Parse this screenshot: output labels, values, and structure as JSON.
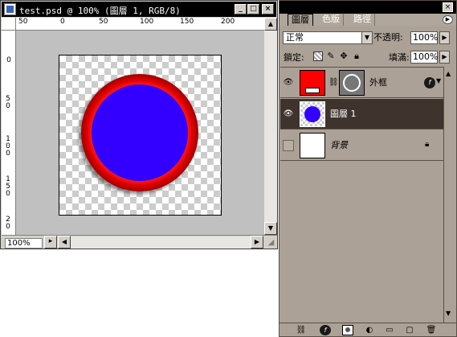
{
  "document": {
    "title": "test.psd @ 100% (圖層 1, RGB/8)",
    "zoom": "100%",
    "ruler_top_labels": [
      "50",
      "0",
      "50",
      "100",
      "150",
      "200"
    ],
    "ruler_left_labels": [
      {
        "text": "0"
      },
      {
        "text": "5 0"
      },
      {
        "text": "1 0 0"
      },
      {
        "text": "1 5 0"
      },
      {
        "text": "2 0"
      }
    ]
  },
  "layers_panel": {
    "tabs": [
      "圖層",
      "色版",
      "路徑"
    ],
    "blend_mode": "正常",
    "opacity_label": "不透明:",
    "opacity_value": "100%",
    "lock_label": "鎖定:",
    "fill_label": "填滿:",
    "fill_value": "100%",
    "layers": [
      {
        "name": "外框",
        "visible": true,
        "selected": false,
        "thumb_color": "#ff0000",
        "has_effects": true
      },
      {
        "name": "圖層 1",
        "visible": true,
        "selected": true,
        "thumb_color": "#3300ff",
        "has_effects": false
      },
      {
        "name": "背景",
        "visible": false,
        "selected": false,
        "thumb_color": "#ffffff",
        "locked": true,
        "italic": true
      }
    ]
  },
  "colors": {
    "circle_fill": "#3300ff",
    "ring": "#e00000",
    "panel_bg": "#aca196",
    "selected_row": "#3e332d"
  }
}
